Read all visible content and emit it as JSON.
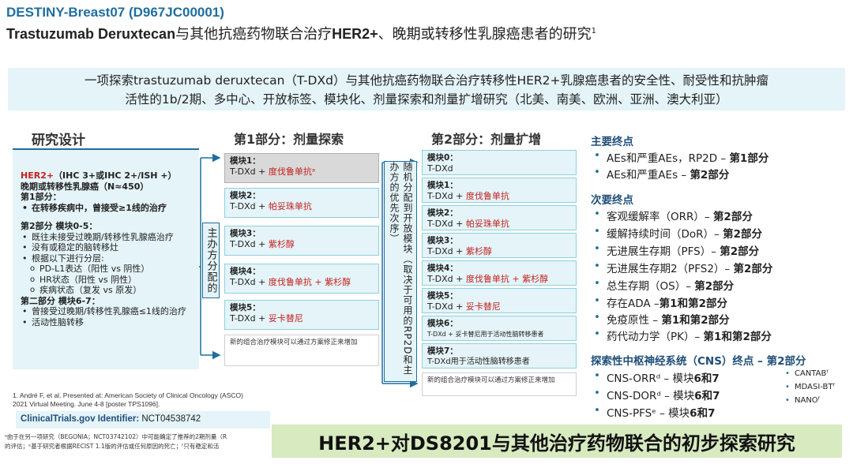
{
  "header": {
    "title": "DESTINY-Breast07 (D967JC00001)",
    "subtitle_drug": "Trastuzumab Deruxtecan",
    "subtitle_mid": "与其他抗癌药物联合治疗",
    "subtitle_her2": "HER2+",
    "subtitle_end": "、晚期或转移性乳腺癌患者的研究",
    "subtitle_sup": "1"
  },
  "intro": {
    "line1": "一项探索trastuzumab deruxtecan（T-DXd）与其他抗癌药物联合治疗转移性HER2+乳腺癌患者的安全性、耐受性和抗肿瘤",
    "line2": "活性的1b/2期、多中心、开放标签、模块化、剂量探索和剂量扩增研究（北美、南美、欧洲、亚洲、澳大利亚）"
  },
  "design": {
    "heading": "研究设计",
    "her2": "HER2+",
    "her2_rest": "（IHC 3+或IHC 2+/ISH +）",
    "pop": "晚期或转移性乳腺癌（N≈450）",
    "part1": "第1部分：",
    "part1_b1": "在转移疾病中，曾接受≥1线的治疗",
    "part2": "第2部分 模块0-5：",
    "part2_b1": "既往未接受过晚期/转移性乳腺癌治疗",
    "part2_b2": "没有或稳定的脑转移灶",
    "part2_b3": "根据以下进行分层:",
    "part2_s1": "PD-L1表达（阳性 vs 阴性）",
    "part2_s2": "HR状态（阳性 vs 阴性）",
    "part2_s3": "疾病状态（复发 vs 原发）",
    "part2b": "第二部分 模块6-7：",
    "part2b_b1": "曾接受过晚期/转移性乳腺癌≤1线的治疗",
    "part2b_b2": "活动性脑转移"
  },
  "alloc1": "主办方分配的",
  "alloc2": "随机分配到开放模块（取决于可用的RP2D和主办方的优先次序）",
  "part1": {
    "heading": "第1部分：剂量探索",
    "modules": [
      {
        "title": "模块1：",
        "base": "T-DXd + ",
        "drug": "度伐鲁单抗ᵃ"
      },
      {
        "title": "模块2：",
        "base": "T-DXd + ",
        "drug": "帕妥珠单抗"
      },
      {
        "title": "模块3：",
        "base": "T-DXd + ",
        "drug": "紫杉醇"
      },
      {
        "title": "模块4：",
        "base": "T-DXd + ",
        "drug": "度伐鲁单抗 + 紫杉醇"
      },
      {
        "title": "模块5：",
        "base": "T-DXd + ",
        "drug": "妥卡替尼"
      }
    ],
    "note": "新的组合治疗模块可以通过方案修正来增加"
  },
  "part2": {
    "heading": "第2部分：剂量扩增",
    "modules": [
      {
        "title": "模块0：",
        "base": "T-DXd",
        "drug": ""
      },
      {
        "title": "模块1：",
        "base": "T-DXd + ",
        "drug": "度伐鲁单抗"
      },
      {
        "title": "模块2：",
        "base": "T-DXd + ",
        "drug": "帕妥珠单抗"
      },
      {
        "title": "模块3：",
        "base": "T-DXd + ",
        "drug": "紫杉醇"
      },
      {
        "title": "模块4：",
        "base": "T-DXd + ",
        "drug": "度伐鲁单抗 + 紫杉醇"
      },
      {
        "title": "模块5：",
        "base": "T-DXd + ",
        "drug": "妥卡替尼"
      },
      {
        "title": "模块6：",
        "base": "T-DXd + 妥卡替尼用于活动性脑转移患者",
        "drug": ""
      },
      {
        "title": "模块7：",
        "base": "T-DXd用于活动性脑转移患者",
        "drug": ""
      }
    ],
    "note": "新的组合治疗模块可以通过方案修正来增加"
  },
  "endpoints": {
    "primary_h": "主要终点",
    "primary": [
      {
        "t": "AEs和严重AEs，RP2D – ",
        "b": "第1部分"
      },
      {
        "t": "AEs和严重AEs – ",
        "b": "第2部分"
      }
    ],
    "secondary_h": "次要终点",
    "secondary": [
      {
        "t": "客观缓解率（ORR）– ",
        "b": "第2部分"
      },
      {
        "t": "缓解持续时间（DoR）– ",
        "b": "第2部分"
      },
      {
        "t": "无进展生存期（PFS）– ",
        "b": "第2部分"
      },
      {
        "t": "无进展生存期2（PFS2）– ",
        "b": "第2部分"
      },
      {
        "t": "总生存期（OS）– ",
        "b": "第2部分"
      },
      {
        "t": "存在ADA –",
        "b": "第1和第2部分"
      },
      {
        "t": "免疫原性 – ",
        "b": "第1和第2部分"
      },
      {
        "t": "药代动力学（PK）– ",
        "b": "第1和第2部分"
      }
    ],
    "cns_h": "探索性中枢神经系统（CNS）终点 – 第2部分",
    "cns": [
      {
        "t": "CNS-ORRᵈ – 模块",
        "b": "6和7"
      },
      {
        "t": "CNS-DORᵈ – 模块",
        "b": "6和7"
      },
      {
        "t": "CNS-PFSᵉ – 模块",
        "b": "6和7"
      }
    ],
    "cns_extra": [
      "CANTABᶠ",
      "MDASI-BTᶠ",
      "NANOᶠ"
    ]
  },
  "reference": "1. André F, et al. Presented at: American Society of Clinical Oncology (ASCO) 2021 Virtual Meeting. June 4-8 [poster TPS1096].",
  "clinicaltrials": {
    "label": "ClinicalTrials.gov Identifier: ",
    "value": "NCT04538742"
  },
  "footnote1": "ᵃ由于在另一项研究（BEGONIA；NCT03742102）中可能确定了推荐的2期剂量（R",
  "footnote2": "的评估；ᵉ基于研究者根据RECIST 1.1版的评估或任何原因的死亡；ᶠ只有稳定和活",
  "banner": "HER2+对DS8201与其他治疗药物联合的初步探索研究"
}
